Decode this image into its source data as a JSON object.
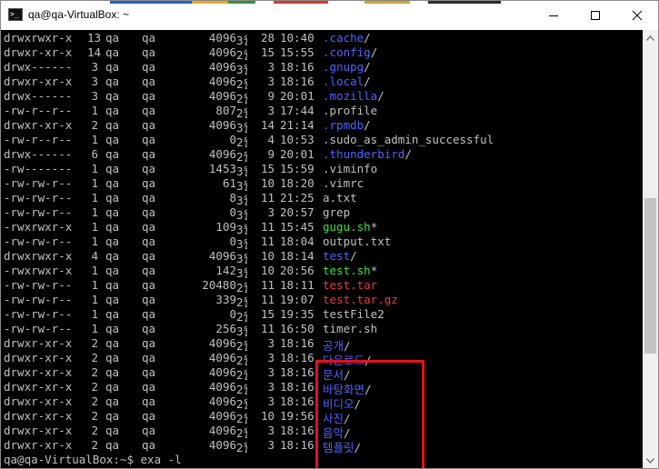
{
  "window": {
    "title": "qa@qa-VirtualBox: ~",
    "buttons": {
      "minimize": "minimize-icon",
      "maximize": "maximize-icon",
      "close": "close-icon"
    }
  },
  "colors": {
    "directory": "#4f63ff",
    "executable": "#35e63a",
    "archive": "#f03a3a",
    "plain": "#c0c0c0",
    "highlight_box": "#e3111b"
  },
  "listing": [
    {
      "perm": "drwxrwxr-x",
      "links": "13",
      "user": "qa",
      "group": "qa",
      "size": "4096",
      "month": "3월",
      "day": "28",
      "time": "10:40",
      "name": ".cache",
      "suffix": "/",
      "kind": "dir"
    },
    {
      "perm": "drwxr-xr-x",
      "links": "14",
      "user": "qa",
      "group": "qa",
      "size": "4096",
      "month": "2월",
      "day": "15",
      "time": "15:55",
      "name": ".config",
      "suffix": "/",
      "kind": "dir"
    },
    {
      "perm": "drwx------",
      "links": "3",
      "user": "qa",
      "group": "qa",
      "size": "4096",
      "month": "3월",
      "day": "3",
      "time": "18:16",
      "name": ".gnupg",
      "suffix": "/",
      "kind": "dir"
    },
    {
      "perm": "drwxr-xr-x",
      "links": "3",
      "user": "qa",
      "group": "qa",
      "size": "4096",
      "month": "2월",
      "day": "3",
      "time": "18:16",
      "name": ".local",
      "suffix": "/",
      "kind": "dir"
    },
    {
      "perm": "drwx------",
      "links": "3",
      "user": "qa",
      "group": "qa",
      "size": "4096",
      "month": "2월",
      "day": "9",
      "time": "20:01",
      "name": ".mozilla",
      "suffix": "/",
      "kind": "dir"
    },
    {
      "perm": "-rw-r--r--",
      "links": "1",
      "user": "qa",
      "group": "qa",
      "size": "807",
      "month": "2월",
      "day": "3",
      "time": "17:44",
      "name": ".profile",
      "suffix": "",
      "kind": "plain"
    },
    {
      "perm": "drwxr-xr-x",
      "links": "2",
      "user": "qa",
      "group": "qa",
      "size": "4096",
      "month": "3월",
      "day": "14",
      "time": "21:14",
      "name": ".rpmdb",
      "suffix": "/",
      "kind": "dir"
    },
    {
      "perm": "-rw-r--r--",
      "links": "1",
      "user": "qa",
      "group": "qa",
      "size": "0",
      "month": "2월",
      "day": "4",
      "time": "10:53",
      "name": ".sudo_as_admin_successful",
      "suffix": "",
      "kind": "plain"
    },
    {
      "perm": "drwx------",
      "links": "6",
      "user": "qa",
      "group": "qa",
      "size": "4096",
      "month": "2월",
      "day": "9",
      "time": "20:01",
      "name": ".thunderbird",
      "suffix": "/",
      "kind": "dir"
    },
    {
      "perm": "-rw-------",
      "links": "1",
      "user": "qa",
      "group": "qa",
      "size": "1453",
      "month": "3월",
      "day": "15",
      "time": "15:59",
      "name": ".viminfo",
      "suffix": "",
      "kind": "plain"
    },
    {
      "perm": "-rw-rw-r--",
      "links": "1",
      "user": "qa",
      "group": "qa",
      "size": "61",
      "month": "3월",
      "day": "10",
      "time": "18:20",
      "name": ".vimrc",
      "suffix": "",
      "kind": "plain"
    },
    {
      "perm": "-rw-rw-r--",
      "links": "1",
      "user": "qa",
      "group": "qa",
      "size": "8",
      "month": "3월",
      "day": "11",
      "time": "21:25",
      "name": "a.txt",
      "suffix": "",
      "kind": "plain"
    },
    {
      "perm": "-rw-rw-r--",
      "links": "1",
      "user": "qa",
      "group": "qa",
      "size": "0",
      "month": "3월",
      "day": "3",
      "time": "20:57",
      "name": "grep",
      "suffix": "",
      "kind": "plain"
    },
    {
      "perm": "-rwxrwxr-x",
      "links": "1",
      "user": "qa",
      "group": "qa",
      "size": "109",
      "month": "3월",
      "day": "11",
      "time": "15:45",
      "name": "gugu.sh",
      "suffix": "*",
      "kind": "exec"
    },
    {
      "perm": "-rw-rw-r--",
      "links": "1",
      "user": "qa",
      "group": "qa",
      "size": "0",
      "month": "3월",
      "day": "11",
      "time": "18:04",
      "name": "output.txt",
      "suffix": "",
      "kind": "plain"
    },
    {
      "perm": "drwxrwxr-x",
      "links": "4",
      "user": "qa",
      "group": "qa",
      "size": "4096",
      "month": "3월",
      "day": "10",
      "time": "18:14",
      "name": "test",
      "suffix": "/",
      "kind": "dir"
    },
    {
      "perm": "-rwxrwxr-x",
      "links": "1",
      "user": "qa",
      "group": "qa",
      "size": "142",
      "month": "3월",
      "day": "10",
      "time": "20:56",
      "name": "test.sh",
      "suffix": "*",
      "kind": "exec"
    },
    {
      "perm": "-rw-rw-r--",
      "links": "1",
      "user": "qa",
      "group": "qa",
      "size": "20480",
      "month": "2월",
      "day": "11",
      "time": "18:11",
      "name": "test.tar",
      "suffix": "",
      "kind": "archive"
    },
    {
      "perm": "-rw-rw-r--",
      "links": "1",
      "user": "qa",
      "group": "qa",
      "size": "339",
      "month": "2월",
      "day": "11",
      "time": "19:07",
      "name": "test.tar.gz",
      "suffix": "",
      "kind": "archive"
    },
    {
      "perm": "-rw-rw-r--",
      "links": "1",
      "user": "qa",
      "group": "qa",
      "size": "0",
      "month": "2월",
      "day": "15",
      "time": "19:35",
      "name": "testFile2",
      "suffix": "",
      "kind": "plain"
    },
    {
      "perm": "-rw-rw-r--",
      "links": "1",
      "user": "qa",
      "group": "qa",
      "size": "256",
      "month": "3월",
      "day": "11",
      "time": "16:50",
      "name": "timer.sh",
      "suffix": "",
      "kind": "plain"
    },
    {
      "perm": "drwxr-xr-x",
      "links": "2",
      "user": "qa",
      "group": "qa",
      "size": "4096",
      "month": "2월",
      "day": "3",
      "time": "18:16",
      "name": "공개",
      "suffix": "/",
      "kind": "dir"
    },
    {
      "perm": "drwxr-xr-x",
      "links": "2",
      "user": "qa",
      "group": "qa",
      "size": "4096",
      "month": "2월",
      "day": "3",
      "time": "18:16",
      "name": "다운로드",
      "suffix": "/",
      "kind": "dir"
    },
    {
      "perm": "drwxr-xr-x",
      "links": "2",
      "user": "qa",
      "group": "qa",
      "size": "4096",
      "month": "2월",
      "day": "3",
      "time": "18:16",
      "name": "문서",
      "suffix": "/",
      "kind": "dir"
    },
    {
      "perm": "drwxr-xr-x",
      "links": "2",
      "user": "qa",
      "group": "qa",
      "size": "4096",
      "month": "2월",
      "day": "3",
      "time": "18:16",
      "name": "바탕화면",
      "suffix": "/",
      "kind": "dir"
    },
    {
      "perm": "drwxr-xr-x",
      "links": "2",
      "user": "qa",
      "group": "qa",
      "size": "4096",
      "month": "2월",
      "day": "3",
      "time": "18:16",
      "name": "비디오",
      "suffix": "/",
      "kind": "dir"
    },
    {
      "perm": "drwxr-xr-x",
      "links": "2",
      "user": "qa",
      "group": "qa",
      "size": "4096",
      "month": "2월",
      "day": "10",
      "time": "19:56",
      "name": "사진",
      "suffix": "/",
      "kind": "dir"
    },
    {
      "perm": "drwxr-xr-x",
      "links": "2",
      "user": "qa",
      "group": "qa",
      "size": "4096",
      "month": "2월",
      "day": "3",
      "time": "18:16",
      "name": "음악",
      "suffix": "/",
      "kind": "dir"
    },
    {
      "perm": "drwxr-xr-x",
      "links": "2",
      "user": "qa",
      "group": "qa",
      "size": "4096",
      "month": "2월",
      "day": "3",
      "time": "18:16",
      "name": "템플릿",
      "suffix": "/",
      "kind": "dir"
    }
  ],
  "prompt": {
    "text": "qa@qa-VirtualBox:~$ exa -l"
  }
}
